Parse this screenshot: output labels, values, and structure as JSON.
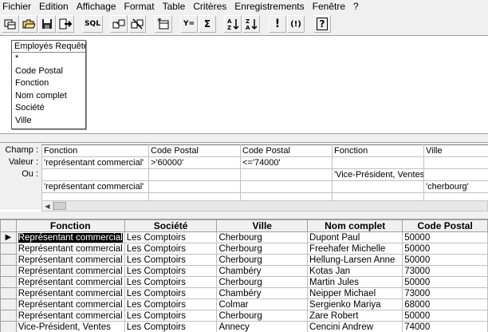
{
  "menu": [
    "Fichier",
    "Edition",
    "Affichage",
    "Format",
    "Table",
    "Critères",
    "Enregistrements",
    "Fenêtre",
    "?"
  ],
  "toolbar": {
    "sql_label": "SQL",
    "sigma_label": "Σ",
    "filter_label": "Y=",
    "exclaim_label": "!",
    "exclaim_paren_label": "(!)",
    "help_label": "?"
  },
  "table_box": {
    "title": "Employés Requête",
    "fields": [
      "*",
      "Code Postal",
      "Fonction",
      "Nom complet",
      "Société",
      "Ville"
    ]
  },
  "criteria": {
    "labels": [
      "Champ :",
      "Valeur :",
      "Ou :"
    ],
    "rows": [
      [
        "Fonction",
        "Code Postal",
        "Code Postal",
        "Fonction",
        "Ville"
      ],
      [
        "'représentant commercial'",
        ">'60000'",
        "<='74000'",
        "",
        ""
      ],
      [
        "",
        "",
        "",
        "'Vice-Président, Ventes'",
        ""
      ],
      [
        "'représentant commercial'",
        "",
        "",
        "",
        "'cherbourg'"
      ],
      [
        "",
        "",
        "",
        "",
        ""
      ]
    ]
  },
  "results": {
    "columns": [
      "Fonction",
      "Société",
      "Ville",
      "Nom complet",
      "Code Postal"
    ],
    "rows": [
      [
        "Représentant commercial",
        "Les Comptoirs",
        "Cherbourg",
        "Dupont Paul",
        "50000"
      ],
      [
        "Représentant commercial",
        "Les Comptoirs",
        "Cherbourg",
        "Freehafer Michelle",
        "50000"
      ],
      [
        "Représentant commercial",
        "Les Comptoirs",
        "Cherbourg",
        "Hellung-Larsen Anne",
        "50000"
      ],
      [
        "Représentant commercial",
        "Les Comptoirs",
        "Chambéry",
        "Kotas Jan",
        "73000"
      ],
      [
        "Représentant commercial",
        "Les Comptoirs",
        "Cherbourg",
        "Martin Jules",
        "50000"
      ],
      [
        "Représentant commercial",
        "Les Comptoirs",
        "Chambéry",
        "Neipper Michael",
        "73000"
      ],
      [
        "Représentant commercial",
        "Les Comptoirs",
        "Colmar",
        "Sergienko Mariya",
        "68000"
      ],
      [
        "Représentant commercial",
        "Les Comptoirs",
        "Cherbourg",
        "Zare Robert",
        "50000"
      ],
      [
        "Vice-Président, Ventes",
        "Les Comptoirs",
        "Annecy",
        "Cencini Andrew",
        "74000"
      ]
    ],
    "current_row": 0
  }
}
